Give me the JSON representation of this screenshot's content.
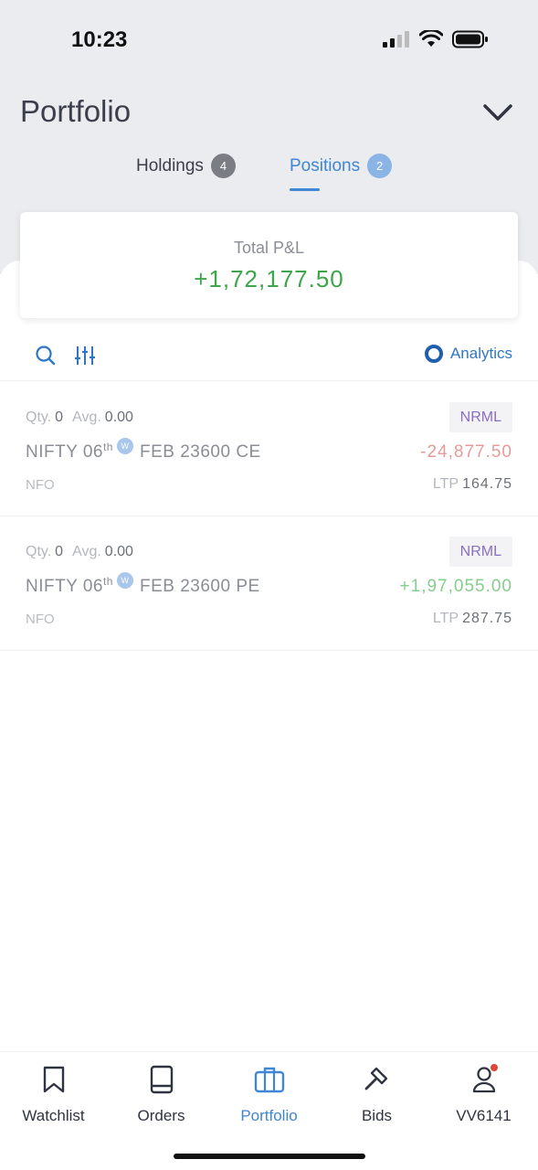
{
  "status_bar": {
    "time": "10:23",
    "icons": [
      "cellular-signal-icon",
      "wifi-icon",
      "battery-icon"
    ]
  },
  "header": {
    "title": "Portfolio",
    "dropdown_icon": "chevron-down-icon"
  },
  "tabs": [
    {
      "label": "Holdings",
      "count": "4",
      "active": false
    },
    {
      "label": "Positions",
      "count": "2",
      "active": true
    }
  ],
  "summary": {
    "label": "Total P&L",
    "value": "+1,72,177.50"
  },
  "toolbar": {
    "search_icon": "search-icon",
    "filter_icon": "filter-sliders-icon",
    "analytics_label": "Analytics"
  },
  "positions": [
    {
      "qty_label": "Qty.",
      "qty": "0",
      "avg_label": "Avg.",
      "avg": "0.00",
      "product": "NRML",
      "symbol": "NIFTY 06",
      "suffix": "th",
      "weekly_marker": "W",
      "contract": "FEB 23600 CE",
      "pnl": "-24,877.50",
      "exchange": "NFO",
      "ltp_label": "LTP",
      "ltp": "164.75"
    },
    {
      "qty_label": "Qty.",
      "qty": "0",
      "avg_label": "Avg.",
      "avg": "0.00",
      "product": "NRML",
      "symbol": "NIFTY 06",
      "suffix": "th",
      "weekly_marker": "W",
      "contract": "FEB 23600 PE",
      "pnl": "+1,97,055.00",
      "exchange": "NFO",
      "ltp_label": "LTP",
      "ltp": "287.75"
    }
  ],
  "bottom_nav": [
    {
      "label": "Watchlist",
      "icon": "bookmark-icon"
    },
    {
      "label": "Orders",
      "icon": "book-icon"
    },
    {
      "label": "Portfolio",
      "icon": "briefcase-icon",
      "active": true
    },
    {
      "label": "Bids",
      "icon": "gavel-icon"
    },
    {
      "label": "VV6141",
      "icon": "user-icon"
    }
  ],
  "colors": {
    "accent": "#3f86d4",
    "profit": "#3ea64a",
    "loss": "#e59b9b",
    "background_top": "#ebecef"
  }
}
